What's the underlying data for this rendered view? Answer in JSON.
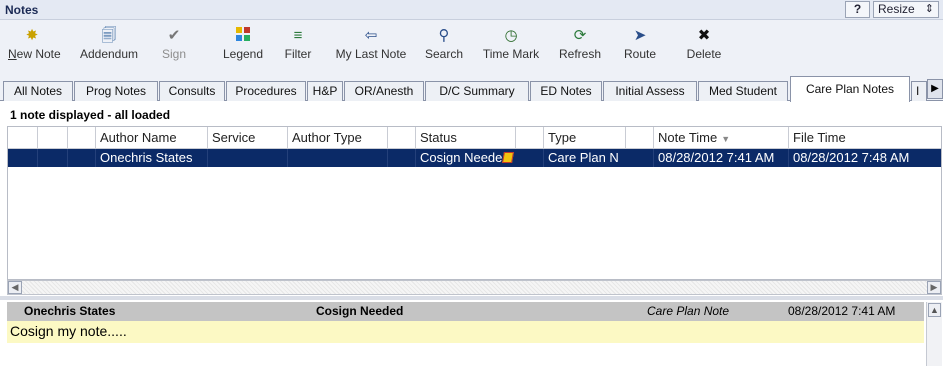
{
  "window": {
    "title": "Notes",
    "help_label": "?",
    "resize_label": "Resize"
  },
  "toolbar": {
    "new_note": "New Note",
    "addendum": "Addendum",
    "sign": "Sign",
    "legend": "Legend",
    "filter": "Filter",
    "my_last_note": "My Last Note",
    "search": "Search",
    "time_mark": "Time Mark",
    "refresh": "Refresh",
    "route": "Route",
    "delete": "Delete"
  },
  "tabs": [
    "All Notes",
    "Prog Notes",
    "Consults",
    "Procedures",
    "H&P",
    "OR/Anesth",
    "D/C Summary",
    "ED Notes",
    "Initial Assess",
    "Med Student",
    "Care Plan Notes",
    "I"
  ],
  "active_tab": "Care Plan Notes",
  "status_line": "1 note displayed - all loaded",
  "grid": {
    "columns": [
      "Author Name",
      "Service",
      "Author Type",
      "Status",
      "Type",
      "Note Time",
      "File Time"
    ],
    "sort_column": "Note Time",
    "rows": [
      {
        "author_name": "Onechris States",
        "service": "",
        "author_type": "",
        "status": "Cosign Neede",
        "type": "Care Plan N",
        "note_time": "08/28/2012 7:41 AM",
        "file_time": "08/28/2012 7:48 AM"
      }
    ]
  },
  "preview": {
    "author": "Onechris States",
    "status": "Cosign Needed",
    "note_type": "Care Plan Note",
    "time": "08/28/2012 7:41 AM",
    "body": "Cosign my note....."
  },
  "colors": {
    "selected_row": "#0b2a67",
    "preview_body": "#fcf9c4",
    "preview_header": "#c4c4c4"
  }
}
